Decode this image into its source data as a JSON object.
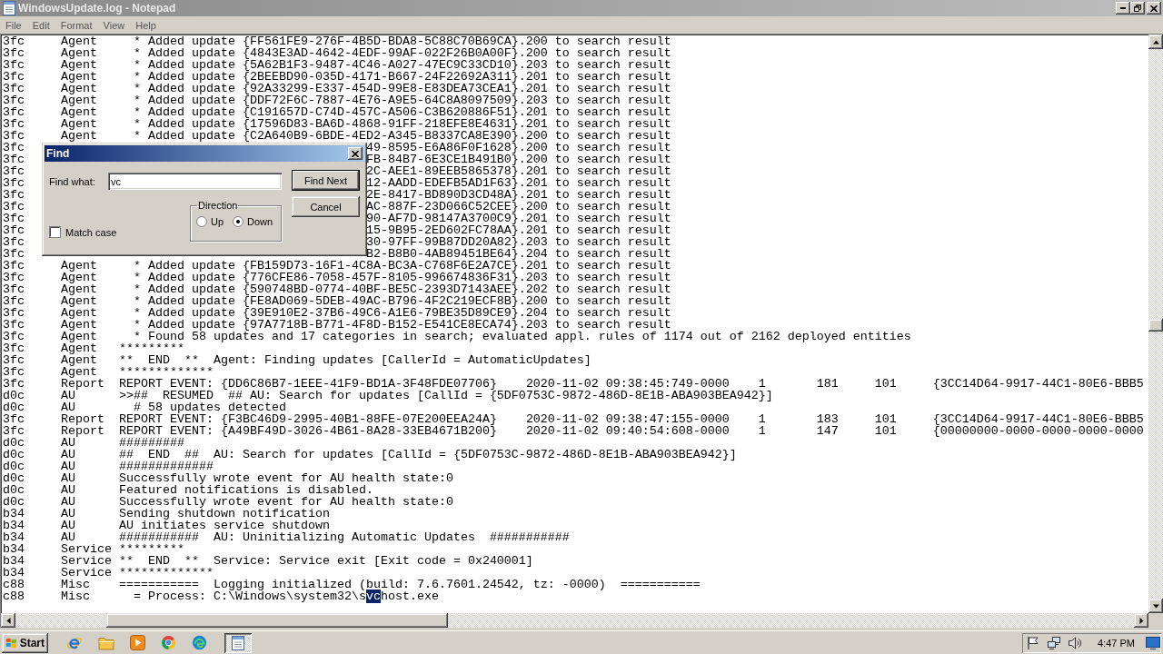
{
  "window": {
    "title": "WindowsUpdate.log - Notepad"
  },
  "menu": [
    "File",
    "Edit",
    "Format",
    "View",
    "Help"
  ],
  "lines": [
    {
      "kind": "entry",
      "thread": "3fc",
      "component": "Agent",
      "message": "  * Added update {FF561FE9-276F-4B5D-BDA8-5C88C70B69CA}.200 to search result"
    },
    {
      "kind": "entry",
      "thread": "3fc",
      "component": "Agent",
      "message": "  * Added update {4843E3AD-4642-4EDF-99AF-022F26B0A00F}.200 to search result"
    },
    {
      "kind": "entry",
      "thread": "3fc",
      "component": "Agent",
      "message": "  * Added update {5A62B1F3-9487-4C46-A027-47EC9C33CD10}.203 to search result"
    },
    {
      "kind": "entry",
      "thread": "3fc",
      "component": "Agent",
      "message": "  * Added update {2BEEBD90-035D-4171-B667-24F22692A311}.201 to search result"
    },
    {
      "kind": "entry",
      "thread": "3fc",
      "component": "Agent",
      "message": "  * Added update {92A33299-E337-454D-99E8-E83DEA73CEA1}.201 to search result"
    },
    {
      "kind": "entry",
      "thread": "3fc",
      "component": "Agent",
      "message": "  * Added update {DDF72F6C-7887-4E76-A9E5-64C8A8097509}.203 to search result"
    },
    {
      "kind": "entry",
      "thread": "3fc",
      "component": "Agent",
      "message": "  * Added update {C191657D-C74D-457C-A506-C3B620886F51}.201 to search result"
    },
    {
      "kind": "entry",
      "thread": "3fc",
      "component": "Agent",
      "message": "  * Added update {17596D83-BA6D-4868-91FF-218EFE8E4631}.201 to search result"
    },
    {
      "kind": "entry",
      "thread": "3fc",
      "component": "Agent",
      "message": "  * Added update {C2A640B9-6BDE-4ED2-A345-B8337CA8E390}.200 to search result"
    },
    {
      "kind": "covered",
      "thread": "3fc",
      "tail": "49-8595-E6A86F0F1628}.200 to search result"
    },
    {
      "kind": "covered",
      "thread": "3fc",
      "tail": "FB-84B7-6E3CE1B491B0}.200 to search result"
    },
    {
      "kind": "covered",
      "thread": "3fc",
      "tail": "2C-AEE1-89EEB5865378}.201 to search result"
    },
    {
      "kind": "covered",
      "thread": "3fc",
      "tail": "12-AADD-EDEFB5AD1F63}.201 to search result"
    },
    {
      "kind": "covered",
      "thread": "3fc",
      "tail": "2E-8417-BD890D3CD48A}.201 to search result"
    },
    {
      "kind": "covered",
      "thread": "3fc",
      "tail": "AC-887F-23D066C52CEE}.200 to search result"
    },
    {
      "kind": "covered",
      "thread": "3fc",
      "tail": "90-AF7D-98147A3700C9}.201 to search result"
    },
    {
      "kind": "covered",
      "thread": "3fc",
      "tail": "15-9B95-2ED602FC78AA}.201 to search result"
    },
    {
      "kind": "covered",
      "thread": "3fc",
      "tail": "30-97FF-99B87DD20A82}.203 to search result"
    },
    {
      "kind": "covered",
      "thread": "3fc",
      "tail": "B2-B8B0-4AB89451BE64}.204 to search result"
    },
    {
      "kind": "entry",
      "thread": "3fc",
      "component": "Agent",
      "message": "  * Added update {FB159D73-16F1-4C8A-BC3A-C768F6E2A7CE}.201 to search result"
    },
    {
      "kind": "entry",
      "thread": "3fc",
      "component": "Agent",
      "message": "  * Added update {776CFE86-7058-457F-8105-996674836F31}.203 to search result"
    },
    {
      "kind": "entry",
      "thread": "3fc",
      "component": "Agent",
      "message": "  * Added update {590748BD-0774-40BF-BE5C-2393D7143AEE}.202 to search result"
    },
    {
      "kind": "entry",
      "thread": "3fc",
      "component": "Agent",
      "message": "  * Added update {FE8AD069-5DEB-49AC-B796-4F2C219ECF8B}.200 to search result"
    },
    {
      "kind": "entry",
      "thread": "3fc",
      "component": "Agent",
      "message": "  * Added update {39E910E2-37B6-49C6-A1E6-79BE35D89CE9}.204 to search result"
    },
    {
      "kind": "entry",
      "thread": "3fc",
      "component": "Agent",
      "message": "  * Added update {97A7718B-B771-4F8D-B152-E541CE8ECA74}.203 to search result"
    },
    {
      "kind": "entry",
      "thread": "3fc",
      "component": "Agent",
      "message": "  * Found 58 updates and 17 categories in search; evaluated appl. rules of 1174 out of 2162 deployed entities"
    },
    {
      "kind": "entry",
      "thread": "3fc",
      "component": "Agent",
      "message": "*********"
    },
    {
      "kind": "entry",
      "thread": "3fc",
      "component": "Agent",
      "message": "**  END  **  Agent: Finding updates [CallerId = AutomaticUpdates]"
    },
    {
      "kind": "entry",
      "thread": "3fc",
      "component": "Agent",
      "message": "*************"
    },
    {
      "kind": "entry",
      "thread": "3fc",
      "component": "Report",
      "message": "REPORT EVENT: {DD6C86B7-1EEE-41F9-BD1A-3F48FDE07706}\t2020-11-02 09:38:45:749-0000\t1\t181\t101\t{3CC14D64-9917-44C1-80E6-BBB5"
    },
    {
      "kind": "entry",
      "thread": "d0c",
      "component": "AU",
      "message": ">>##  RESUMED  ## AU: Search for updates [CallId = {5DF0753C-9872-486D-8E1B-ABA903BEA942}]"
    },
    {
      "kind": "entry",
      "thread": "d0c",
      "component": "AU",
      "message": "  # 58 updates detected"
    },
    {
      "kind": "entry",
      "thread": "3fc",
      "component": "Report",
      "message": "REPORT EVENT: {F3BC46D9-2995-40B1-88FE-07E200EEA24A}\t2020-11-02 09:38:47:155-0000\t1\t183\t101\t{3CC14D64-9917-44C1-80E6-BBB5"
    },
    {
      "kind": "entry",
      "thread": "3fc",
      "component": "Report",
      "message": "REPORT EVENT: {A49BF49D-3026-4B61-8A28-33EB4671B200}\t2020-11-02 09:40:54:608-0000\t1\t147\t101\t{00000000-0000-0000-0000-0000"
    },
    {
      "kind": "entry",
      "thread": "d0c",
      "component": "AU",
      "message": "#########"
    },
    {
      "kind": "entry",
      "thread": "d0c",
      "component": "AU",
      "message": "##  END  ##  AU: Search for updates [CallId = {5DF0753C-9872-486D-8E1B-ABA903BEA942}]"
    },
    {
      "kind": "entry",
      "thread": "d0c",
      "component": "AU",
      "message": "#############"
    },
    {
      "kind": "entry",
      "thread": "d0c",
      "component": "AU",
      "message": "Successfully wrote event for AU health state:0"
    },
    {
      "kind": "entry",
      "thread": "d0c",
      "component": "AU",
      "message": "Featured notifications is disabled."
    },
    {
      "kind": "entry",
      "thread": "d0c",
      "component": "AU",
      "message": "Successfully wrote event for AU health state:0"
    },
    {
      "kind": "entry",
      "thread": "b34",
      "component": "AU",
      "message": "Sending shutdown notification"
    },
    {
      "kind": "entry",
      "thread": "b34",
      "component": "AU",
      "message": "AU initiates service shutdown"
    },
    {
      "kind": "entry",
      "thread": "b34",
      "component": "AU",
      "message": "###########  AU: Uninitializing Automatic Updates  ###########"
    },
    {
      "kind": "entry",
      "thread": "b34",
      "component": "Service",
      "message": "*********"
    },
    {
      "kind": "entry",
      "thread": "b34",
      "component": "Service",
      "message": "**  END  **  Service: Service exit [Exit code = 0x240001]"
    },
    {
      "kind": "entry",
      "thread": "b34",
      "component": "Service",
      "message": "*************"
    },
    {
      "kind": "entry",
      "thread": "c88",
      "component": "Misc",
      "message": "===========  Logging initialized (build: 7.6.7601.24542, tz: -0000)  ==========="
    },
    {
      "kind": "entry",
      "thread": "c88",
      "component": "Misc",
      "segments": [
        {
          "text": "  = Process: C:\\Windows\\system32\\s",
          "selected": false
        },
        {
          "text": "vc",
          "selected": true
        },
        {
          "text": "host.exe",
          "selected": false
        }
      ]
    }
  ],
  "find_dialog": {
    "title": "Find",
    "find_what": {
      "label": "Find what:",
      "value": "vc"
    },
    "match_case": {
      "label": "Match case",
      "checked": false
    },
    "direction": {
      "label": "Direction",
      "options": [
        {
          "label": "Up",
          "selected": false
        },
        {
          "label": "Down",
          "selected": true
        }
      ]
    },
    "buttons": [
      {
        "label": "Find Next",
        "default": true
      },
      {
        "label": "Cancel",
        "default": false
      }
    ]
  },
  "taskbar": {
    "start_label": "Start",
    "task_button": {
      "active": true
    },
    "clock": "4:47 PM"
  }
}
